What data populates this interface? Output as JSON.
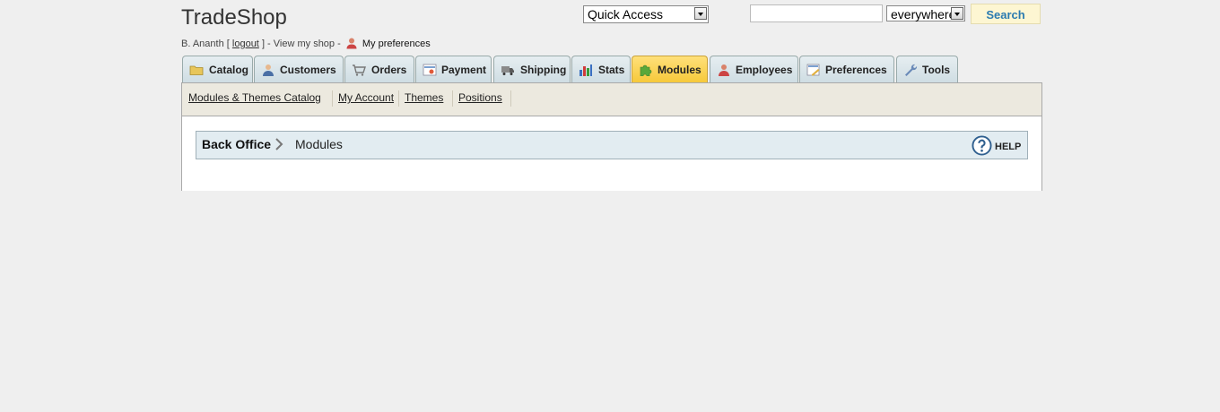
{
  "header": {
    "shop_name": "TradeShop",
    "user_name": "B. Ananth [",
    "logout_label": "logout",
    "view_shop_text": "] - View my shop -",
    "preferences_link": "My preferences"
  },
  "quick_access": {
    "selected": "Quick Access"
  },
  "search": {
    "input_value": "",
    "scope_selected": "everywhere",
    "button_label": "Search"
  },
  "tabs": [
    {
      "label": "Catalog",
      "icon": "folder-icon",
      "active": false
    },
    {
      "label": "Customers",
      "icon": "customer-icon",
      "active": false
    },
    {
      "label": "Orders",
      "icon": "cart-icon",
      "active": false
    },
    {
      "label": "Payment",
      "icon": "payment-icon",
      "active": false
    },
    {
      "label": "Shipping",
      "icon": "truck-icon",
      "active": false
    },
    {
      "label": "Stats",
      "icon": "bar-chart-icon",
      "active": false
    },
    {
      "label": "Modules",
      "icon": "puzzle-icon",
      "active": true
    },
    {
      "label": "Employees",
      "icon": "employee-icon",
      "active": false
    },
    {
      "label": "Preferences",
      "icon": "preferences-icon",
      "active": false
    },
    {
      "label": "Tools",
      "icon": "wrench-icon",
      "active": false
    }
  ],
  "subnav": [
    {
      "label": "Modules & Themes Catalog"
    },
    {
      "label": "My Account"
    },
    {
      "label": "Themes"
    },
    {
      "label": "Positions"
    }
  ],
  "breadcrumb": {
    "root": "Back Office",
    "current": "Modules",
    "help_label": "HELP"
  },
  "colors": {
    "active_tab": "#f6c93a",
    "tab": "#cfdde3",
    "subbar": "#ece9df",
    "breadcrumb_bg": "#e2ecf1",
    "search_text": "#2a7bb0"
  }
}
